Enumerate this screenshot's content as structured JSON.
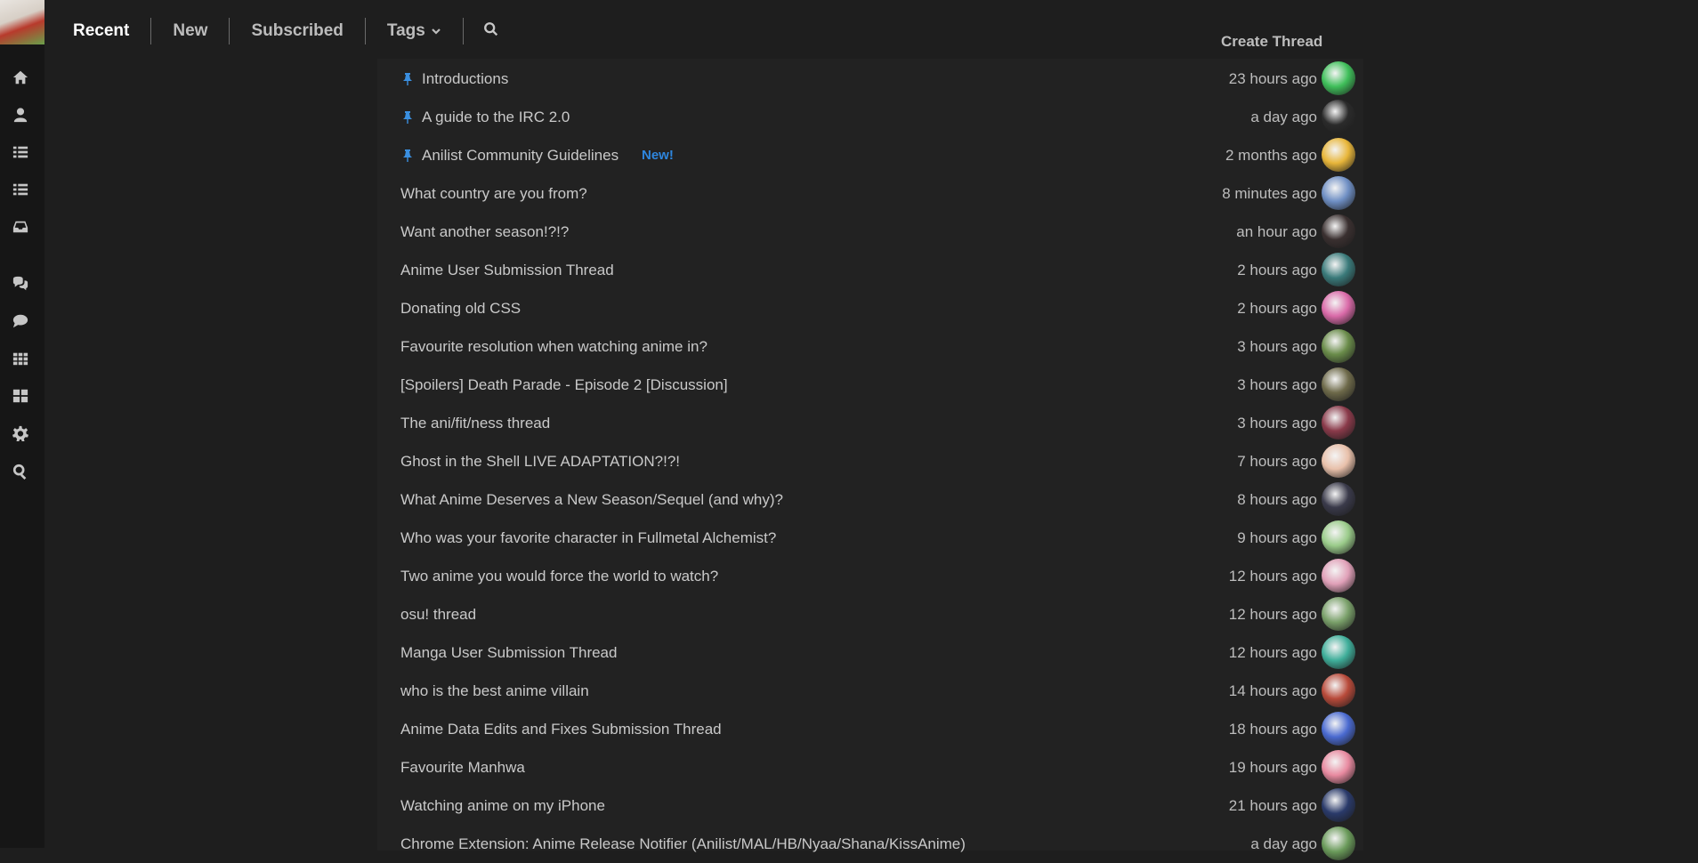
{
  "nav": {
    "recent": "Recent",
    "new": "New",
    "subscribed": "Subscribed",
    "tags": "Tags"
  },
  "create_thread": "Create Thread",
  "new_badge": "New!",
  "rail_icons": [
    "home-icon",
    "user-icon",
    "list-icon",
    "list-alt-icon",
    "inbox-icon",
    "comments-icon",
    "comment-icon",
    "grid-icon",
    "dashboard-icon",
    "gear-icon",
    "search-icon"
  ],
  "threads": [
    {
      "title": "Introductions",
      "time": "23 hours ago",
      "pinned": true,
      "is_new": false,
      "avatar": "#3fbf5a"
    },
    {
      "title": "A guide to the IRC 2.0",
      "time": "a day ago",
      "pinned": true,
      "is_new": false,
      "avatar": "#2b2b2b"
    },
    {
      "title": "Anilist Community Guidelines",
      "time": "2 months ago",
      "pinned": true,
      "is_new": true,
      "avatar": "#e8b63a"
    },
    {
      "title": "What country are you from?",
      "time": "8 minutes ago",
      "pinned": false,
      "is_new": false,
      "avatar": "#6f8fc4"
    },
    {
      "title": "Want another season!?!?",
      "time": "an hour ago",
      "pinned": false,
      "is_new": false,
      "avatar": "#3a3030"
    },
    {
      "title": "Anime User Submission Thread",
      "time": "2 hours ago",
      "pinned": false,
      "is_new": false,
      "avatar": "#3a7a7a"
    },
    {
      "title": "Donating old CSS",
      "time": "2 hours ago",
      "pinned": false,
      "is_new": false,
      "avatar": "#d96aa8"
    },
    {
      "title": "Favourite resolution when watching anime in?",
      "time": "3 hours ago",
      "pinned": false,
      "is_new": false,
      "avatar": "#6a8c4a"
    },
    {
      "title": "[Spoilers] Death Parade - Episode 2 [Discussion]",
      "time": "3 hours ago",
      "pinned": false,
      "is_new": false,
      "avatar": "#6e6a4a"
    },
    {
      "title": "The ani/fit/ness thread",
      "time": "3 hours ago",
      "pinned": false,
      "is_new": false,
      "avatar": "#8a3a4a"
    },
    {
      "title": "Ghost in the Shell LIVE ADAPTATION?!?!",
      "time": "7 hours ago",
      "pinned": false,
      "is_new": false,
      "avatar": "#e8c0aa"
    },
    {
      "title": "What Anime Deserves a New Season/Sequel (and why)?",
      "time": "8 hours ago",
      "pinned": false,
      "is_new": false,
      "avatar": "#3a3a4a"
    },
    {
      "title": "Who was your favorite character in Fullmetal Alchemist?",
      "time": "9 hours ago",
      "pinned": false,
      "is_new": false,
      "avatar": "#9acb8a"
    },
    {
      "title": "Two anime you would force the world to watch?",
      "time": "12 hours ago",
      "pinned": false,
      "is_new": false,
      "avatar": "#e0a0b8"
    },
    {
      "title": "osu! thread",
      "time": "12 hours ago",
      "pinned": false,
      "is_new": false,
      "avatar": "#7aa06a"
    },
    {
      "title": "Manga User Submission Thread",
      "time": "12 hours ago",
      "pinned": false,
      "is_new": false,
      "avatar": "#3fae9a"
    },
    {
      "title": "who is the best anime villain",
      "time": "14 hours ago",
      "pinned": false,
      "is_new": false,
      "avatar": "#b84a3a"
    },
    {
      "title": "Anime Data Edits and Fixes Submission Thread",
      "time": "18 hours ago",
      "pinned": false,
      "is_new": false,
      "avatar": "#4a6ad0"
    },
    {
      "title": "Favourite Manhwa",
      "time": "19 hours ago",
      "pinned": false,
      "is_new": false,
      "avatar": "#e88aa0"
    },
    {
      "title": "Watching anime on my iPhone",
      "time": "21 hours ago",
      "pinned": false,
      "is_new": false,
      "avatar": "#2a3a6a"
    },
    {
      "title": "Chrome Extension: Anime Release Notifier (Anilist/MAL/HB/Nyaa/Shana/KissAnime)",
      "time": "a day ago",
      "pinned": false,
      "is_new": false,
      "avatar": "#6a9a5a"
    }
  ]
}
